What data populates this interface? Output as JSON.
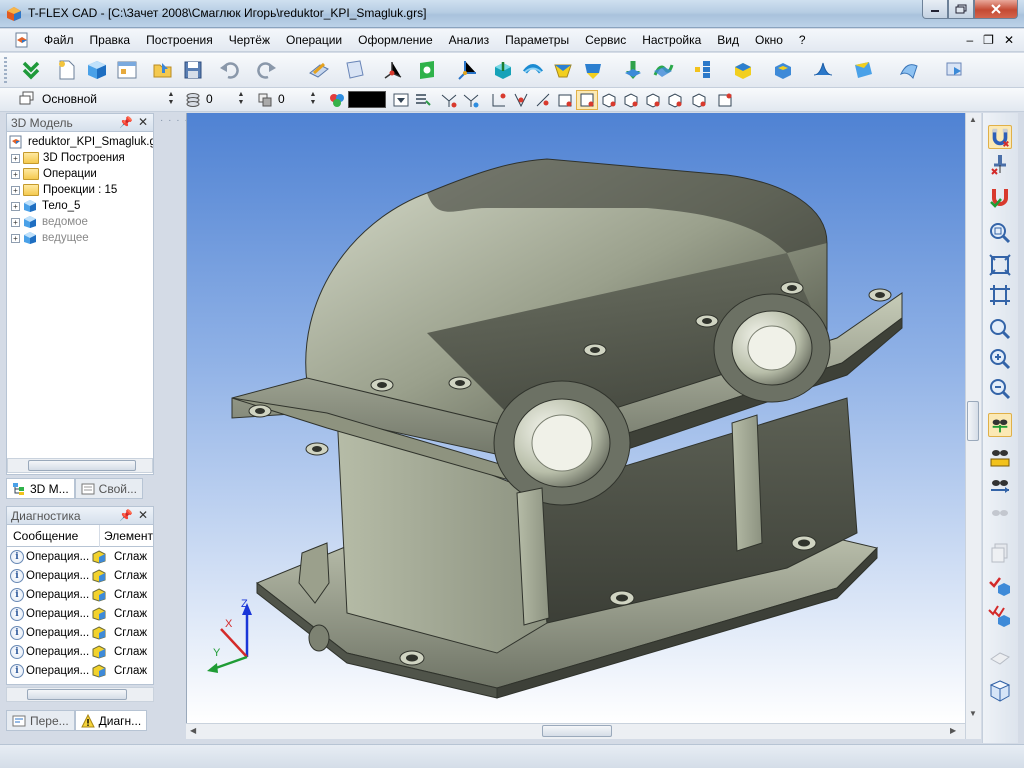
{
  "window": {
    "title": "T-FLEX CAD - [C:\\Зачет 2008\\Смаглюк Игорь\\reduktor_KPI_Smagluk.grs]"
  },
  "menu": {
    "items": [
      "Файл",
      "Правка",
      "Построения",
      "Чертёж",
      "Операции",
      "Оформление",
      "Анализ",
      "Параметры",
      "Сервис",
      "Настройка",
      "Вид",
      "Окно",
      "?"
    ]
  },
  "toolbar2": {
    "layer_value": "Основной",
    "level_value": "0",
    "priority_value": "0",
    "color_swatch": "#000000"
  },
  "model_panel": {
    "title": "3D Модель",
    "tree": [
      {
        "label": "reduktor_KPI_Smagluk.grs",
        "type": "root"
      },
      {
        "label": "3D Построения",
        "type": "folder"
      },
      {
        "label": "Операции",
        "type": "folder"
      },
      {
        "label": "Проекции : 15",
        "type": "folder"
      },
      {
        "label": "Тело_5",
        "type": "body"
      },
      {
        "label": "ведомое",
        "type": "body-muted"
      },
      {
        "label": "ведущее",
        "type": "body-muted"
      }
    ],
    "tabs": [
      "3D М...",
      "Свой..."
    ]
  },
  "diagnostics_panel": {
    "title": "Диагностика",
    "columns": [
      "Сообщение",
      "Элемент"
    ],
    "rows": [
      {
        "message": "Операция...",
        "element": "Сглаж"
      },
      {
        "message": "Операция...",
        "element": "Сглаж"
      },
      {
        "message": "Операция...",
        "element": "Сглаж"
      },
      {
        "message": "Операция...",
        "element": "Сглаж"
      },
      {
        "message": "Операция...",
        "element": "Сглаж"
      },
      {
        "message": "Операция...",
        "element": "Сглаж"
      },
      {
        "message": "Операция...",
        "element": "Сглаж"
      }
    ],
    "tabs": [
      "Пере...",
      "Диагн..."
    ]
  },
  "viewport": {
    "axis_labels": {
      "z": "Z",
      "x": "X",
      "y": "Y"
    }
  },
  "colors": {
    "viewport_top": "#4f82d3",
    "viewport_bottom": "#ffffff",
    "model_body": "#b8bfae"
  }
}
